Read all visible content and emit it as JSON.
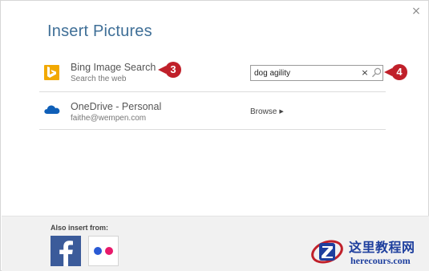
{
  "dialog": {
    "title": "Insert Pictures",
    "close_glyph": "×"
  },
  "sources": [
    {
      "icon": "bing-icon",
      "title": "Bing Image Search",
      "subtitle": "Search the web"
    },
    {
      "icon": "onedrive-cloud-icon",
      "title": "OneDrive - Personal",
      "subtitle": "faithe@wempen.com"
    }
  ],
  "search": {
    "value": "dog agility",
    "placeholder": "",
    "clear_glyph": "×"
  },
  "browse": {
    "label": "Browse",
    "arrow_glyph": "▶"
  },
  "callouts": [
    {
      "number": "3",
      "color": "#c0202a"
    },
    {
      "number": "4",
      "color": "#c0202a"
    }
  ],
  "footer": {
    "also_insert_label": "Also insert from:",
    "services": [
      {
        "name": "facebook-icon",
        "color": "#3b5b9a"
      },
      {
        "name": "flickr-icon",
        "colors": [
          "#2a5ad4",
          "#e8196a"
        ]
      }
    ]
  },
  "watermark": {
    "site_name": "这里教程网",
    "url": "herecours.com"
  },
  "colors": {
    "title": "#3f6f97",
    "bing": "#f2a900",
    "onedrive": "#0f5fb8"
  }
}
